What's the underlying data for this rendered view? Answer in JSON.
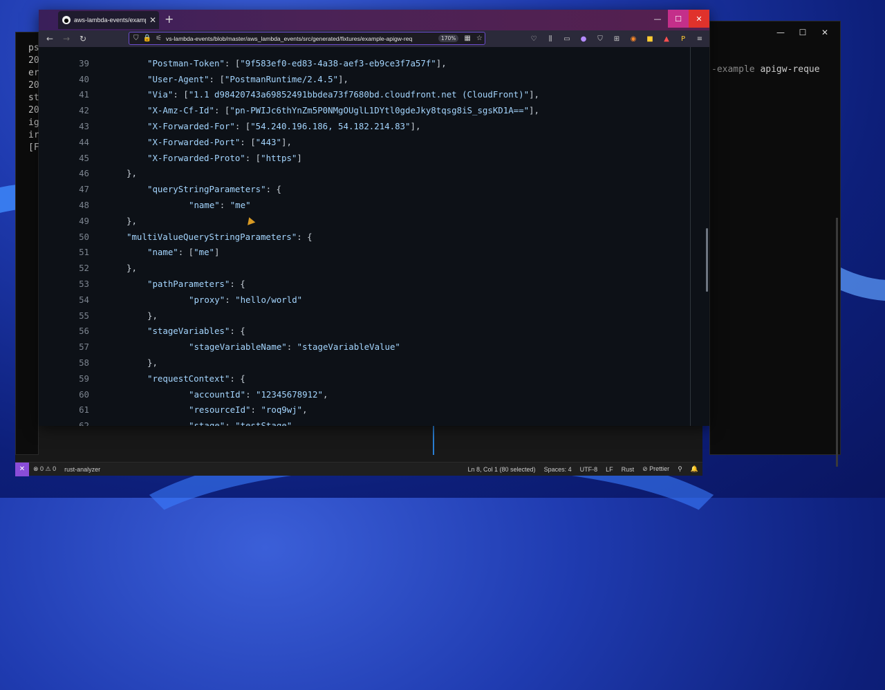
{
  "colors": {
    "accent": "#6c4dd0",
    "code_key": "#a5d6ff",
    "code_punct": "#c9d1d9",
    "line_number": "#7d8590",
    "statusbar_remote": "#8a4dd8",
    "firefox_close": "#e0322c"
  },
  "terminal": {
    "controls": [
      "—",
      "☐",
      "✕"
    ],
    "text_dim": "-example ",
    "text": "apigw-reque"
  },
  "left_terminal": {
    "lines": [
      "ps",
      "20",
      "er",
      "20",
      "st",
      "20",
      "ig",
      "ir",
      "[F"
    ]
  },
  "browser": {
    "tab_title": "aws-lambda-events/example-a",
    "tab_close": "✕",
    "new_tab": "+",
    "window_controls": [
      "—",
      "☐",
      "✕"
    ],
    "nav": {
      "back": "←",
      "forward": "→",
      "reload": "↻"
    },
    "url": "vs-lambda-events/blob/master/aws_lambda_events/src/generated/fixtures/example-apigw-req",
    "zoom": "170%",
    "toolbar_icons": [
      "pocket-icon",
      "library-icon",
      "sidebar-icon",
      "extension-icon",
      "shield-icon",
      "grid-icon",
      "color-icon",
      "lock-icon",
      "rocket-icon",
      "profile-icon",
      "menu-icon"
    ],
    "code_lines": [
      {
        "n": "39",
        "indent": 1,
        "text": "\"Postman-Token\": [\"9f583ef0-ed83-4a38-aef3-eb9ce3f7a57f\"],"
      },
      {
        "n": "40",
        "indent": 1,
        "text": "\"User-Agent\": [\"PostmanRuntime/2.4.5\"],"
      },
      {
        "n": "41",
        "indent": 1,
        "text": "\"Via\": [\"1.1 d98420743a69852491bbdea73f7680bd.cloudfront.net (CloudFront)\"],"
      },
      {
        "n": "42",
        "indent": 1,
        "text": "\"X-Amz-Cf-Id\": [\"pn-PWIJc6thYnZm5P0NMgOUglL1DYtl0gdeJky8tqsg8iS_sgsKD1A==\"],"
      },
      {
        "n": "43",
        "indent": 1,
        "text": "\"X-Forwarded-For\": [\"54.240.196.186, 54.182.214.83\"],"
      },
      {
        "n": "44",
        "indent": 1,
        "text": "\"X-Forwarded-Port\": [\"443\"],"
      },
      {
        "n": "45",
        "indent": 1,
        "text": "\"X-Forwarded-Proto\": [\"https\"]"
      },
      {
        "n": "46",
        "indent": 0,
        "text": "},"
      },
      {
        "n": "47",
        "indent": 1,
        "text": "\"queryStringParameters\": {"
      },
      {
        "n": "48",
        "indent": 2,
        "text": "\"name\": \"me\""
      },
      {
        "n": "49",
        "indent": 0,
        "text": "},"
      },
      {
        "n": "50",
        "indent": 0,
        "text": "\"multiValueQueryStringParameters\": {"
      },
      {
        "n": "51",
        "indent": 1,
        "text": "\"name\": [\"me\"]"
      },
      {
        "n": "52",
        "indent": 0,
        "text": "},"
      },
      {
        "n": "53",
        "indent": 1,
        "text": "\"pathParameters\": {"
      },
      {
        "n": "54",
        "indent": 2,
        "text": "\"proxy\": \"hello/world\""
      },
      {
        "n": "55",
        "indent": 1,
        "text": "},"
      },
      {
        "n": "56",
        "indent": 1,
        "text": "\"stageVariables\": {"
      },
      {
        "n": "57",
        "indent": 2,
        "text": "\"stageVariableName\": \"stageVariableValue\""
      },
      {
        "n": "58",
        "indent": 1,
        "text": "},"
      },
      {
        "n": "59",
        "indent": 1,
        "text": "\"requestContext\": {"
      },
      {
        "n": "60",
        "indent": 2,
        "text": "\"accountId\": \"12345678912\","
      },
      {
        "n": "61",
        "indent": 2,
        "text": "\"resourceId\": \"roq9wj\","
      },
      {
        "n": "62",
        "indent": 2,
        "text": "\"stage\": \"testStage\","
      }
    ]
  },
  "statusbar": {
    "remote": "✕",
    "problems": "⊗ 0 ⚠ 0",
    "language_server": "rust-analyzer",
    "cursor": "Ln 8, Col 1 (80 selected)",
    "spaces": "Spaces: 4",
    "encoding": "UTF-8",
    "eol": "LF",
    "language": "Rust",
    "formatter": "⊘ Prettier",
    "feedback": "⚲",
    "bell": "🔔"
  }
}
